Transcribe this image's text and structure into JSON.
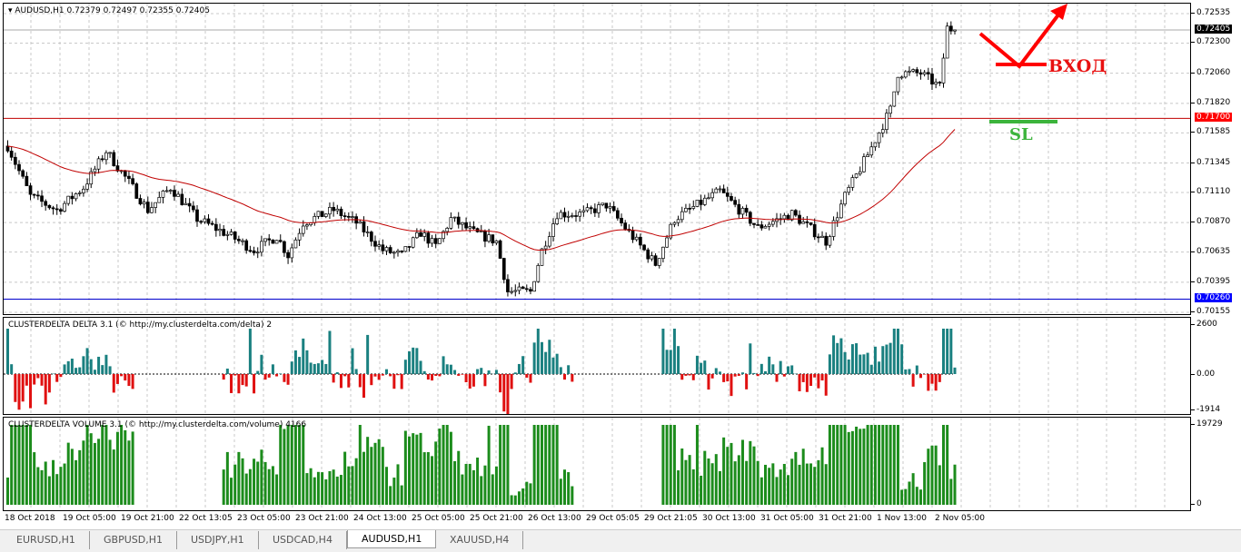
{
  "main": {
    "title": "AUDUSD,H1  0.72379 0.72497 0.72355 0.72405",
    "price_labels": [
      "0.72535",
      "0.72300",
      "0.72060",
      "0.71820",
      "0.71585",
      "0.71345",
      "0.71110",
      "0.70870",
      "0.70635",
      "0.70395",
      "0.70155"
    ],
    "current_price": "0.72405",
    "sl_line_price": "0.71700",
    "support_line_price": "0.70260",
    "annotations": {
      "entry": "ВХОД",
      "stop_loss": "SL"
    },
    "colors": {
      "entry": "#ff0000",
      "sl": "#3cb43c",
      "ma": "#c00000",
      "support": "#0000cc"
    }
  },
  "chart_data": {
    "type": "candlestick",
    "symbol": "AUDUSD",
    "timeframe": "H1",
    "ylim": [
      0.70155,
      0.72535
    ],
    "close_keypoints": [
      [
        0,
        0.7148
      ],
      [
        6,
        0.7108
      ],
      [
        13,
        0.7097
      ],
      [
        20,
        0.7115
      ],
      [
        26,
        0.7144
      ],
      [
        32,
        0.7119
      ],
      [
        37,
        0.7097
      ],
      [
        43,
        0.7115
      ],
      [
        50,
        0.709
      ],
      [
        59,
        0.7076
      ],
      [
        65,
        0.7065
      ],
      [
        71,
        0.7076
      ],
      [
        74,
        0.7061
      ],
      [
        78,
        0.7087
      ],
      [
        86,
        0.7097
      ],
      [
        92,
        0.7087
      ],
      [
        99,
        0.7065
      ],
      [
        104,
        0.7061
      ],
      [
        109,
        0.7079
      ],
      [
        113,
        0.7068
      ],
      [
        117,
        0.709
      ],
      [
        123,
        0.7079
      ],
      [
        129,
        0.7072
      ],
      [
        132,
        0.7032
      ],
      [
        138,
        0.7032
      ],
      [
        141,
        0.7065
      ],
      [
        145,
        0.7094
      ],
      [
        152,
        0.7094
      ],
      [
        158,
        0.7101
      ],
      [
        164,
        0.7079
      ],
      [
        171,
        0.7054
      ],
      [
        176,
        0.709
      ],
      [
        188,
        0.7112
      ],
      [
        198,
        0.7083
      ],
      [
        207,
        0.7094
      ],
      [
        216,
        0.7072
      ],
      [
        221,
        0.7108
      ],
      [
        227,
        0.7141
      ],
      [
        233,
        0.7177
      ],
      [
        235,
        0.7206
      ],
      [
        241,
        0.7206
      ],
      [
        246,
        0.7195
      ],
      [
        248,
        0.7242
      ],
      [
        250,
        0.72405
      ]
    ]
  },
  "delta": {
    "title": "CLUSTERDELTA DELTA 3.1 (© http://my.clusterdelta.com/delta) 2",
    "labels": [
      "2600",
      "0.00",
      "-1914"
    ]
  },
  "volume": {
    "title": "CLUSTERDELTA VOLUME 3.1 (© http://my.clusterdelta.com/volume) 4166",
    "labels": [
      "19729",
      "0"
    ]
  },
  "time_labels": [
    "18 Oct 2018",
    "19 Oct 05:00",
    "19 Oct 21:00",
    "22 Oct 13:05",
    "23 Oct 05:00",
    "23 Oct 21:00",
    "24 Oct 13:00",
    "25 Oct 05:00",
    "25 Oct 21:00",
    "26 Oct 13:00",
    "29 Oct 05:05",
    "29 Oct 21:05",
    "30 Oct 13:00",
    "31 Oct 05:00",
    "31 Oct 21:00",
    "1 Nov 13:00",
    "2 Nov 05:00"
  ],
  "tabs": [
    {
      "label": "EURUSD,H1"
    },
    {
      "label": "GBPUSD,H1"
    },
    {
      "label": "USDJPY,H1"
    },
    {
      "label": "USDCAD,H4"
    },
    {
      "label": "AUDUSD,H1",
      "active": true
    },
    {
      "label": "XAUUSD,H4"
    }
  ]
}
